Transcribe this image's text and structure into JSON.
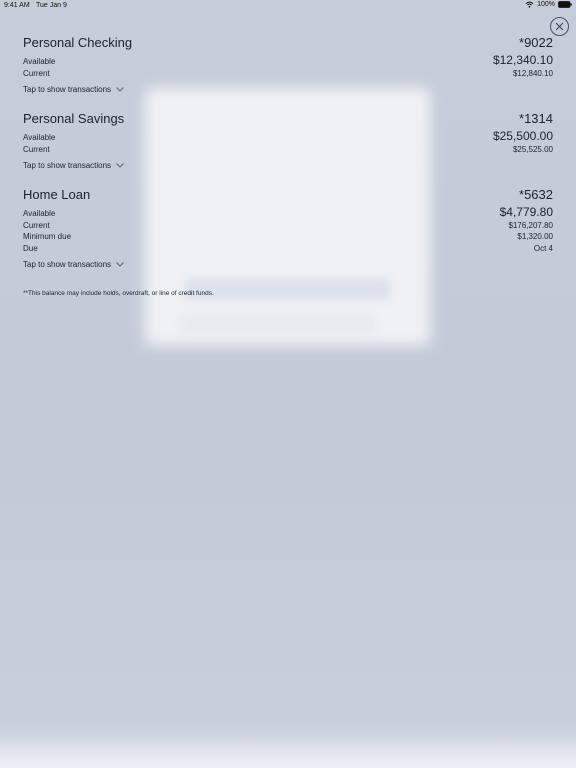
{
  "status_bar": {
    "time": "9:41 AM",
    "date": "Tue Jan 9",
    "battery": "100%"
  },
  "accounts": [
    {
      "name": "Personal Checking",
      "number": "*9022",
      "rows": [
        {
          "label": "Available",
          "value": "$12,340.10"
        },
        {
          "label": "Current",
          "value": "$12,840.10"
        }
      ],
      "toggle_label": "Tap to show transactions"
    },
    {
      "name": "Personal Savings",
      "number": "*1314",
      "rows": [
        {
          "label": "Available",
          "value": "$25,500.00"
        },
        {
          "label": "Current",
          "value": "$25,525.00"
        }
      ],
      "toggle_label": "Tap to show transactions"
    },
    {
      "name": "Home Loan",
      "number": "*5632",
      "rows": [
        {
          "label": "Available",
          "value": "$4,779.80"
        },
        {
          "label": "Current",
          "value": "$176,207.80"
        },
        {
          "label": "Minimum due",
          "value": "$1,320.00"
        },
        {
          "label": "Due",
          "value": "Oct 4"
        }
      ],
      "toggle_label": "Tap to show transactions"
    }
  ],
  "footnote": "**This balance may include holds, overdraft, or line of credit funds.",
  "icons": {
    "close": "close-icon",
    "chevron": "chevron-down-icon",
    "wifi": "wifi-icon",
    "battery": "battery-icon"
  }
}
